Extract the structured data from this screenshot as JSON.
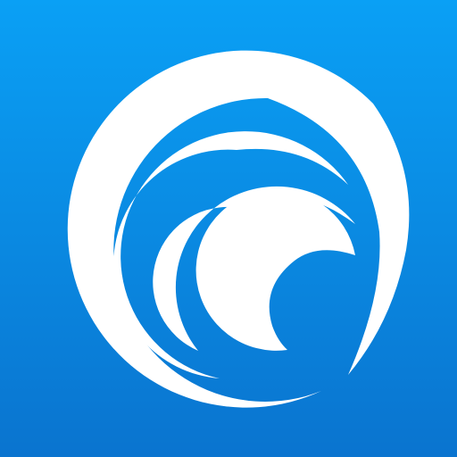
{
  "icon": {
    "name": "wave-logo-icon",
    "colors": {
      "background_top": "#0aa0f5",
      "background_bottom": "#0a74cf",
      "mark": "#ffffff"
    }
  }
}
